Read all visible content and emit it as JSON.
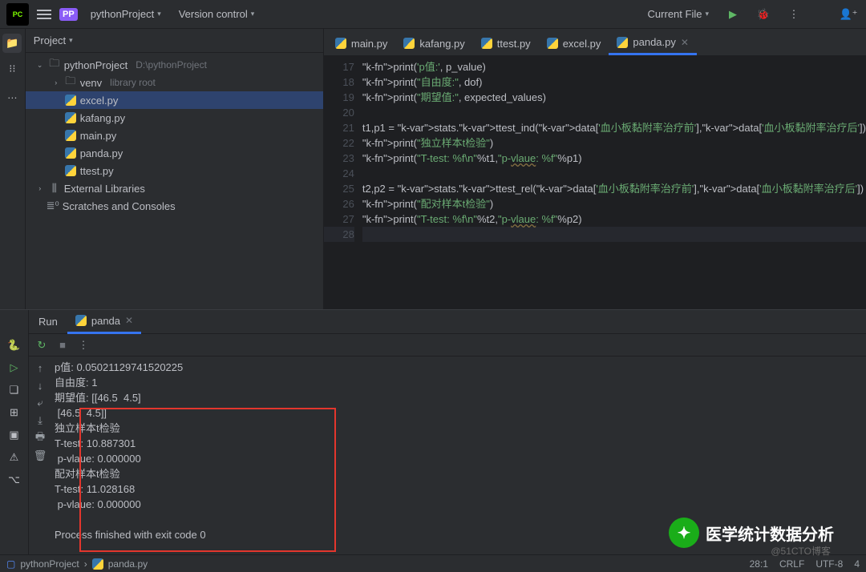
{
  "header": {
    "project": "pythonProject",
    "vcs": "Version control",
    "runConfig": "Current File"
  },
  "projectPanel": {
    "title": "Project",
    "root": "pythonProject",
    "rootPath": "D:\\pythonProject",
    "venv": "venv",
    "venvHint": "library root",
    "files": [
      "excel.py",
      "kafang.py",
      "main.py",
      "panda.py",
      "ttest.py"
    ],
    "ext": "External Libraries",
    "scratch": "Scratches and Consoles"
  },
  "editorTabs": [
    "main.py",
    "kafang.py",
    "ttest.py",
    "excel.py",
    "panda.py"
  ],
  "code": {
    "startLine": 17,
    "lines": [
      "print('p值:', p_value)",
      "print(\"自由度:\", dof)",
      "print(\"期望值:\", expected_values)",
      "",
      "t1,p1 = stats.ttest_ind(data['血小板黏附率治疗前'],data['血小板黏附率治疗后'])",
      "print(\"独立样本t检验\")",
      "print(\"T-test: %f\\n\"%t1,\"p-vlaue: %f\"%p1)",
      "",
      "t2,p2 = stats.ttest_rel(data['血小板黏附率治疗前'],data['血小板黏附率治疗后'])",
      "print(\"配对样本t检验\")",
      "print(\"T-test: %f\\n\"%t2,\"p-vlaue: %f\"%p2)",
      ""
    ]
  },
  "run": {
    "label": "Run",
    "tab": "panda",
    "output": [
      "p值: 0.05021129741520225",
      "自由度: 1",
      "期望值: [[46.5  4.5]",
      " [46.5  4.5]]",
      "独立样本t检验",
      "T-test: 10.887301",
      " p-vlaue: 0.000000",
      "配对样本t检验",
      "T-test: 11.028168",
      " p-vlaue: 0.000000",
      "",
      "Process finished with exit code 0"
    ]
  },
  "status": {
    "crumbProject": "pythonProject",
    "crumbFile": "panda.py",
    "pos": "28:1",
    "eol": "CRLF",
    "enc": "UTF-8",
    "indent": "4"
  },
  "watermark": "医学统计数据分析",
  "watermarkSub": "@51CTO博客"
}
